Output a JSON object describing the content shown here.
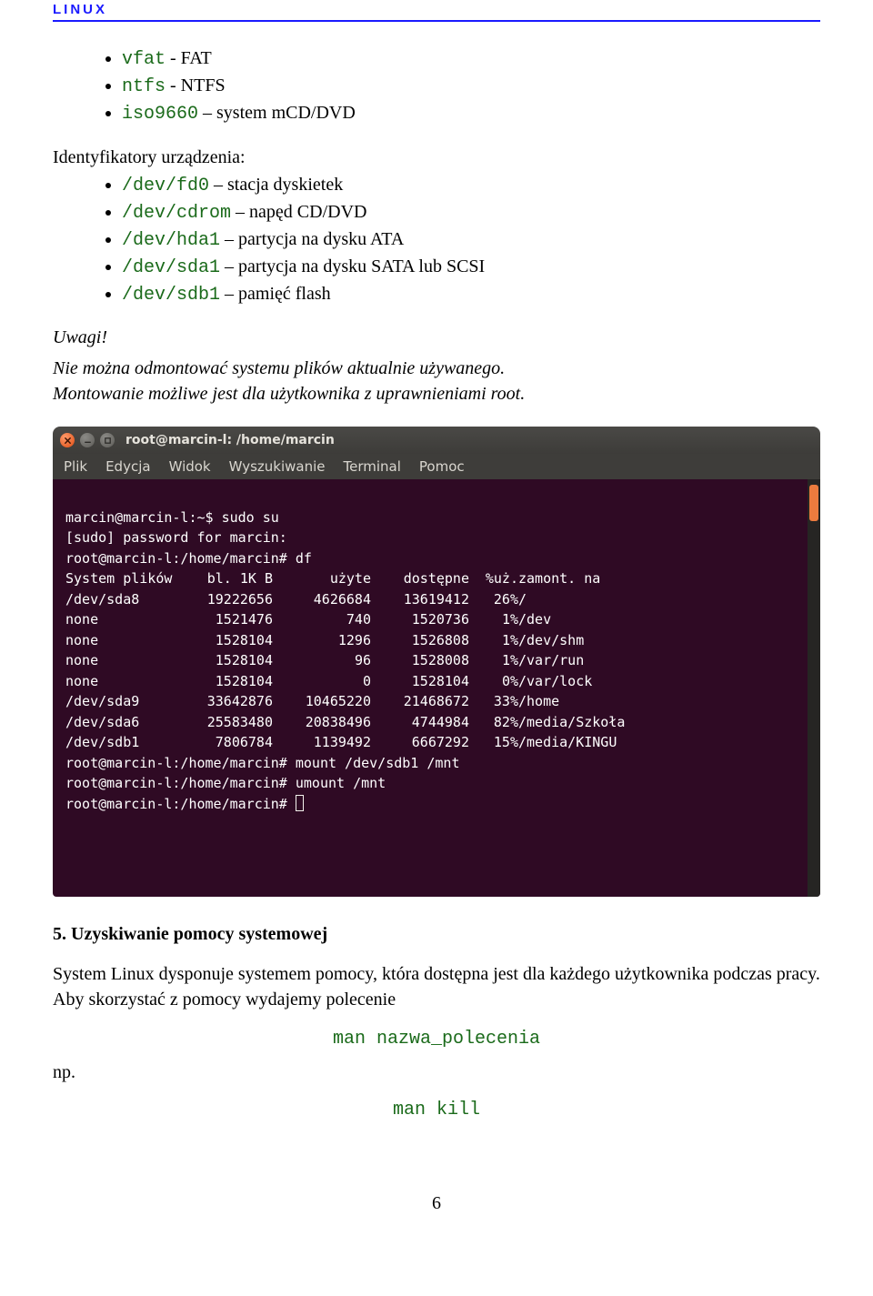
{
  "header": {
    "title": "Linux"
  },
  "fs_types": [
    {
      "code": "vfat",
      "desc": " - FAT"
    },
    {
      "code": "ntfs",
      "desc": " - NTFS"
    },
    {
      "code": "iso9660",
      "desc": " – system mCD/DVD"
    }
  ],
  "ident_label": "Identyfikatory urządzenia:",
  "devices": [
    {
      "code": "/dev/fd0",
      "desc": " – stacja dyskietek"
    },
    {
      "code": "/dev/cdrom",
      "desc": " – napęd CD/DVD"
    },
    {
      "code": "/dev/hda1",
      "desc": " – partycja na dysku ATA"
    },
    {
      "code": "/dev/sda1",
      "desc": " – partycja na dysku SATA lub SCSI"
    },
    {
      "code": "/dev/sdb1",
      "desc": " – pamięć flash"
    }
  ],
  "notes": {
    "heading": "Uwagi!",
    "line1": "Nie można odmontować systemu plików aktualnie używanego.",
    "line2": "Montowanie możliwe jest dla użytkownika z uprawnieniami root."
  },
  "terminal": {
    "title": "root@marcin-l: /home/marcin",
    "menu": [
      "Plik",
      "Edycja",
      "Widok",
      "Wyszukiwanie",
      "Terminal",
      "Pomoc"
    ],
    "prompt_user": "marcin@marcin-l:~$ ",
    "cmd_sudo": "sudo su",
    "sudo_pw": "[sudo] password for marcin:",
    "prompt_root": "root@marcin-l:/home/marcin# ",
    "cmd_df": "df",
    "df_header": {
      "fs": "System plików",
      "bl": "bl.",
      "kb": "1K B",
      "used": "użyte",
      "avail": "dostępne",
      "pct": "%uż.",
      "mount": "zamont. na"
    },
    "df_rows": [
      {
        "fs": "/dev/sda8",
        "bl": "19222656",
        "used": "4626684",
        "avail": "13619412",
        "pct": "26%",
        "mount": "/"
      },
      {
        "fs": "none",
        "bl": "1521476",
        "used": "740",
        "avail": "1520736",
        "pct": "1%",
        "mount": "/dev"
      },
      {
        "fs": "none",
        "bl": "1528104",
        "used": "1296",
        "avail": "1526808",
        "pct": "1%",
        "mount": "/dev/shm"
      },
      {
        "fs": "none",
        "bl": "1528104",
        "used": "96",
        "avail": "1528008",
        "pct": "1%",
        "mount": "/var/run"
      },
      {
        "fs": "none",
        "bl": "1528104",
        "used": "0",
        "avail": "1528104",
        "pct": "0%",
        "mount": "/var/lock"
      },
      {
        "fs": "/dev/sda9",
        "bl": "33642876",
        "used": "10465220",
        "avail": "21468672",
        "pct": "33%",
        "mount": "/home"
      },
      {
        "fs": "/dev/sda6",
        "bl": "25583480",
        "used": "20838496",
        "avail": "4744984",
        "pct": "82%",
        "mount": "/media/Szkoła"
      },
      {
        "fs": "/dev/sdb1",
        "bl": "7806784",
        "used": "1139492",
        "avail": "6667292",
        "pct": "15%",
        "mount": "/media/KINGU"
      }
    ],
    "cmd_mount": "mount /dev/sdb1 /mnt",
    "cmd_umount": "umount /mnt"
  },
  "section5": {
    "heading": "5. Uzyskiwanie pomocy systemowej",
    "para1": "System Linux dysponuje systemem pomocy, która dostępna jest dla każdego użytkownika podczas pracy. Aby skorzystać z pomocy wydajemy polecenie",
    "cmd1": "man nazwa_polecenia",
    "np": "np.",
    "cmd2": "man kill"
  },
  "page_number": "6"
}
